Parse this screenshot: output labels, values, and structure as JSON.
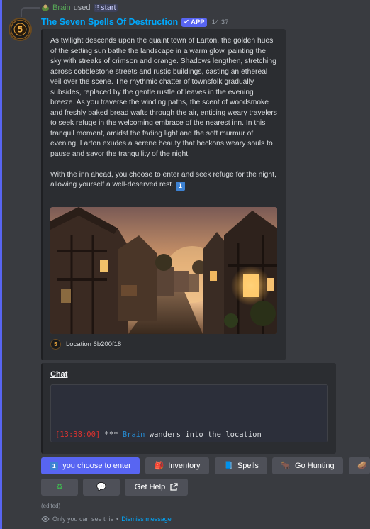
{
  "reply": {
    "user": "Brain",
    "used_text": "used",
    "command": "start"
  },
  "message": {
    "username": "The Seven Spells Of Destruction",
    "badge": "APP",
    "timestamp": "14:37"
  },
  "embed": {
    "paragraph1": "As twilight descends upon the quaint town of Larton, the golden hues of the setting sun bathe the landscape in a warm glow, painting the sky with streaks of crimson and orange. Shadows lengthen, stretching across cobblestone streets and rustic buildings, casting an ethereal veil over the scene. The rhythmic chatter of townsfolk gradually subsides, replaced by the gentle rustle of leaves in the evening breeze. As you traverse the winding paths, the scent of woodsmoke and freshly baked bread wafts through the air, enticing weary travelers to seek refuge in the welcoming embrace of the nearest inn. In this tranquil moment, amidst the fading light and the soft murmur of evening, Larton exudes a serene beauty that beckons weary souls to pause and savor the tranquility of the night.",
    "paragraph2": "With the inn ahead, you choose to enter and seek refuge for the night, allowing yourself a well-deserved rest.",
    "keycap": "1",
    "footer": "Location 6b200f18"
  },
  "chat": {
    "title": "Chat",
    "time": "[13:38:00]",
    "stars": "***",
    "who": "Brain",
    "action": "wanders into the location"
  },
  "buttons": {
    "choice_num": "1",
    "choice": "you choose to enter",
    "inventory": "Inventory",
    "spells": "Spells",
    "hunting": "Go Hunting",
    "get_help": "Get Help"
  },
  "footer": {
    "edited": "(edited)",
    "only_you": "Only you can see this",
    "separator": "•",
    "dismiss": "Dismiss message"
  },
  "colors": {
    "accent": "#5865f2",
    "username": "#00a8fc",
    "background": "#393b40",
    "embed_bg": "#2b2d31"
  }
}
